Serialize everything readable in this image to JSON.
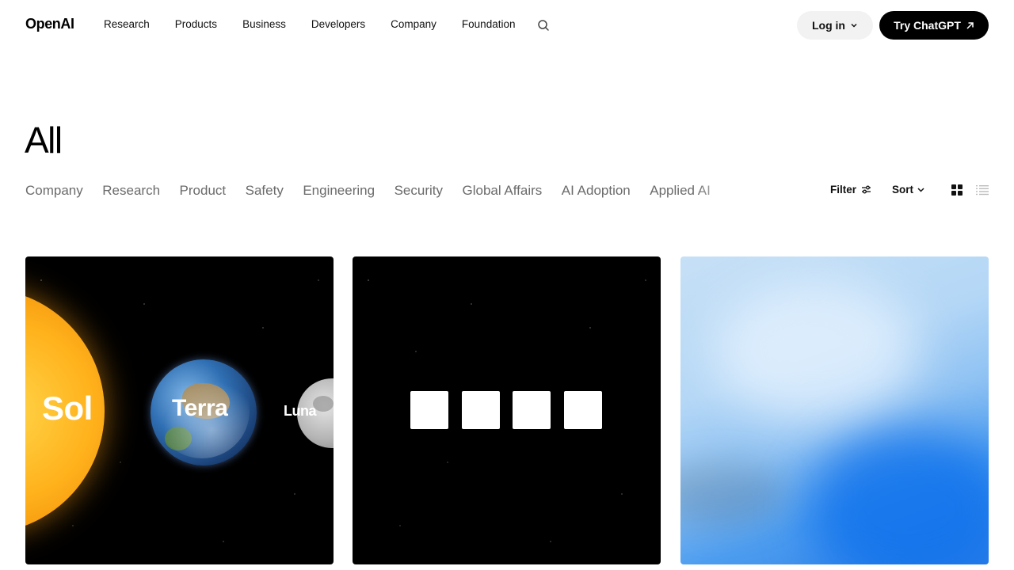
{
  "header": {
    "logo": "OpenAI",
    "nav": [
      "Research",
      "Products",
      "Business",
      "Developers",
      "Company",
      "Foundation"
    ],
    "search_icon": "search-icon",
    "login_label": "Log in",
    "try_label": "Try ChatGPT"
  },
  "page": {
    "title": "All"
  },
  "categories": [
    "Company",
    "Research",
    "Product",
    "Safety",
    "Engineering",
    "Security",
    "Global Affairs",
    "AI Adoption",
    "Applied AI"
  ],
  "toolbar": {
    "filter_label": "Filter",
    "sort_label": "Sort",
    "grid_icon": "grid-view-icon",
    "list_icon": "list-view-icon"
  },
  "cards": {
    "card1": {
      "labels": [
        "Sol",
        "Terra",
        "Luna"
      ]
    },
    "card2": {
      "squares": 4
    },
    "card3": {}
  },
  "colors": {
    "accent": "#000000",
    "login_bg": "#f2f2f2",
    "category_text": "#6b6b6b"
  }
}
